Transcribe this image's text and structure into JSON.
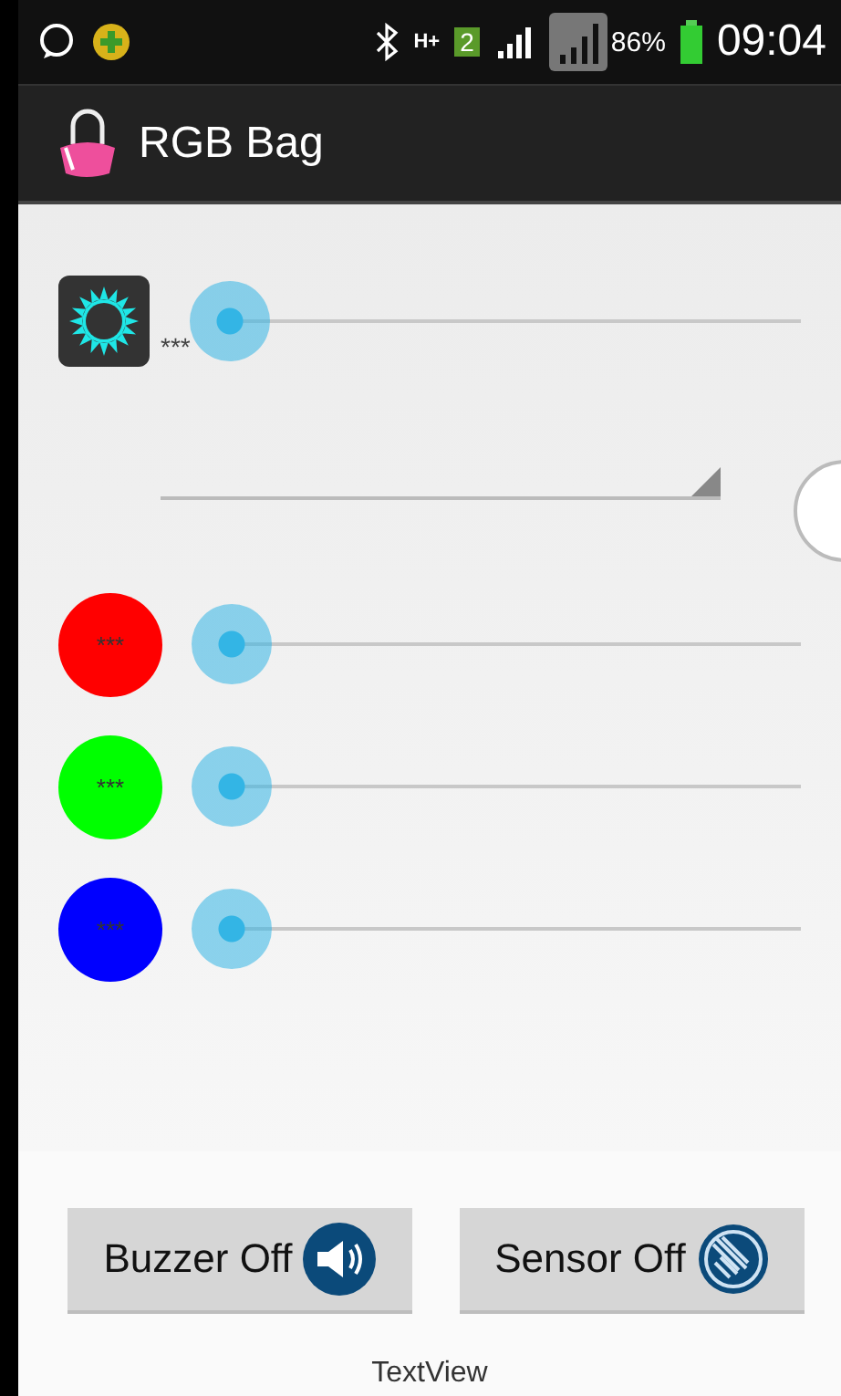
{
  "status_bar": {
    "network": "H+",
    "sim": "2",
    "battery": "86%",
    "time": "09:04"
  },
  "action_bar": {
    "title": "RGB Bag"
  },
  "brightness": {
    "label": "***",
    "level": 0
  },
  "colors": [
    {
      "label": "***",
      "color": "#ff0000",
      "level": 0
    },
    {
      "label": "***",
      "color": "#00ff00",
      "level": 0
    },
    {
      "label": "***",
      "color": "#0000ff",
      "level": 0
    }
  ],
  "buttons": [
    {
      "label": "Buzzer Off",
      "kind": "buzzer"
    },
    {
      "label": "Sensor Off",
      "kind": "sensor"
    }
  ],
  "footer": "TextView"
}
